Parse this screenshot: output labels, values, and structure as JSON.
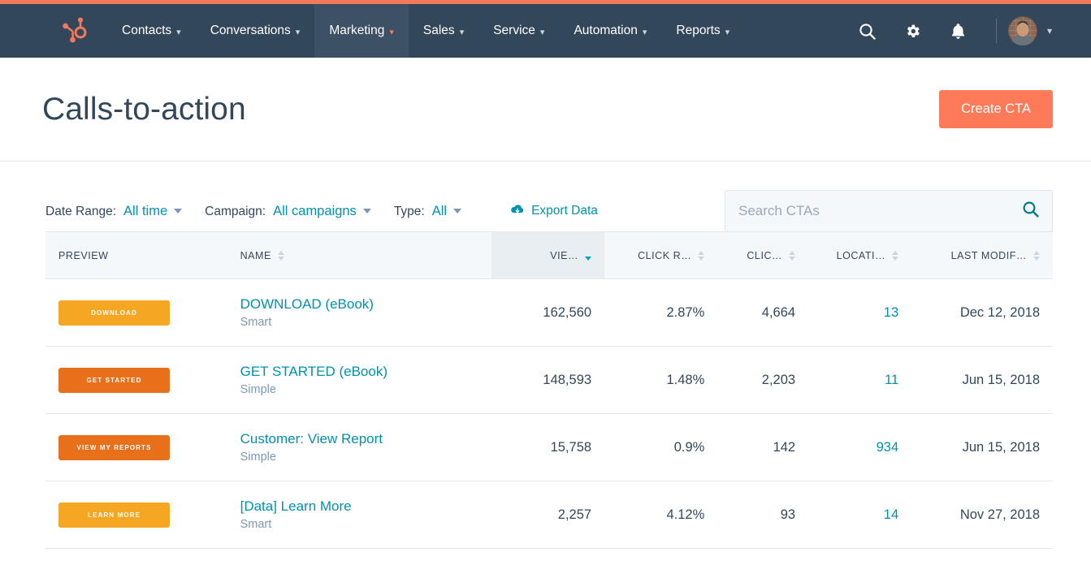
{
  "nav": {
    "logo_name": "hubspot-sprocket-logo",
    "items": [
      {
        "label": "Contacts",
        "active": false
      },
      {
        "label": "Conversations",
        "active": false
      },
      {
        "label": "Marketing",
        "active": true
      },
      {
        "label": "Sales",
        "active": false
      },
      {
        "label": "Service",
        "active": false
      },
      {
        "label": "Automation",
        "active": false
      },
      {
        "label": "Reports",
        "active": false
      }
    ],
    "icons": [
      "search-icon",
      "gear-icon",
      "bell-icon"
    ],
    "avatar_name": "user-avatar"
  },
  "header": {
    "title": "Calls-to-action",
    "create_button": "Create CTA"
  },
  "filters": {
    "date_range_label": "Date Range:",
    "date_range_value": "All time",
    "campaign_label": "Campaign:",
    "campaign_value": "All campaigns",
    "type_label": "Type:",
    "type_value": "All",
    "export_label": "Export Data"
  },
  "search": {
    "placeholder": "Search CTAs",
    "value": ""
  },
  "table": {
    "columns": [
      {
        "label": "PREVIEW",
        "sortable": false,
        "align": "left",
        "sorted": false
      },
      {
        "label": "NAME",
        "sortable": true,
        "align": "left",
        "sorted": false
      },
      {
        "label": "VIE…",
        "sortable": true,
        "align": "right",
        "sorted": true
      },
      {
        "label": "CLICK R…",
        "sortable": true,
        "align": "right",
        "sorted": false
      },
      {
        "label": "CLIC…",
        "sortable": true,
        "align": "right",
        "sorted": false
      },
      {
        "label": "LOCATI…",
        "sortable": true,
        "align": "right",
        "sorted": false
      },
      {
        "label": "LAST MODIF…",
        "sortable": true,
        "align": "right",
        "sorted": false
      }
    ],
    "sort_direction": "descending",
    "rows": [
      {
        "preview_label": "DOWNLOAD",
        "preview_color": "#f5a623",
        "name": "DOWNLOAD (eBook)",
        "type": "Smart",
        "views": "162,560",
        "click_rate": "2.87%",
        "clicks": "4,664",
        "locations": "13",
        "last_modified": "Dec 12, 2018"
      },
      {
        "preview_label": "GET STARTED",
        "preview_color": "#e8701a",
        "name": "GET STARTED (eBook)",
        "type": "Simple",
        "views": "148,593",
        "click_rate": "1.48%",
        "clicks": "2,203",
        "locations": "11",
        "last_modified": "Jun 15, 2018"
      },
      {
        "preview_label": "VIEW MY REPORTS",
        "preview_color": "#e8701a",
        "name": "Customer: View Report",
        "type": "Simple",
        "views": "15,758",
        "click_rate": "0.9%",
        "clicks": "142",
        "locations": "934",
        "last_modified": "Jun 15, 2018"
      },
      {
        "preview_label": "LEARN MORE",
        "preview_color": "#f5a623",
        "name": "[Data] Learn More",
        "type": "Smart",
        "views": "2,257",
        "click_rate": "4.12%",
        "clicks": "93",
        "locations": "14",
        "last_modified": "Nov 27, 2018"
      }
    ]
  },
  "colors": {
    "brand_coral": "#ff7a59",
    "nav_navy": "#33475b",
    "link_teal": "#0091ae",
    "sort_active_teal": "#00a4bd"
  }
}
